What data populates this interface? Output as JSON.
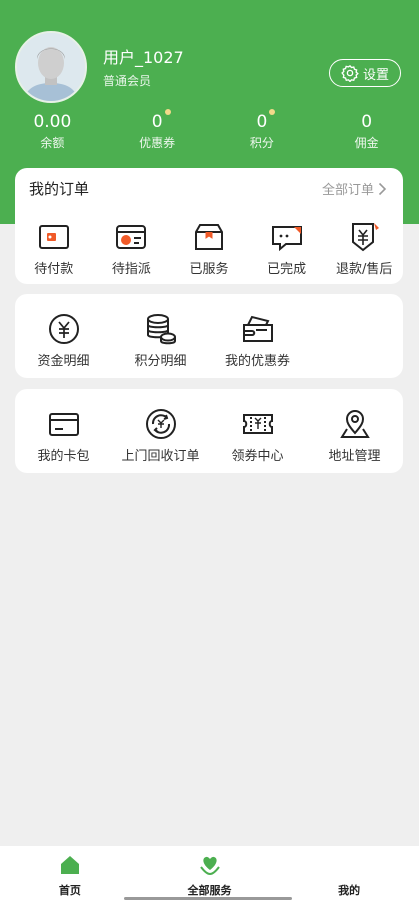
{
  "profile": {
    "username": "用户_1027",
    "level": "普通会员",
    "settings_label": "设置"
  },
  "stats": [
    {
      "value": "0.00",
      "label": "余额",
      "dot": false
    },
    {
      "value": "0",
      "label": "优惠券",
      "dot": true
    },
    {
      "value": "0",
      "label": "积分",
      "dot": true
    },
    {
      "value": "0",
      "label": "佣金",
      "dot": false
    }
  ],
  "orders": {
    "title": "我的订单",
    "all_label": "全部订单",
    "items": [
      "待付款",
      "待指派",
      "已服务",
      "已完成",
      "退款/售后"
    ]
  },
  "assets": {
    "items": [
      "资金明细",
      "积分明细",
      "我的优惠券"
    ]
  },
  "services": {
    "items": [
      "我的卡包",
      "上门回收订单",
      "领券中心",
      "地址管理"
    ]
  },
  "tabbar": {
    "items": [
      "首页",
      "全部服务",
      "我的"
    ]
  },
  "colors": {
    "brand": "#4caf50",
    "accent": "#f05a28",
    "background": "#efefef"
  }
}
